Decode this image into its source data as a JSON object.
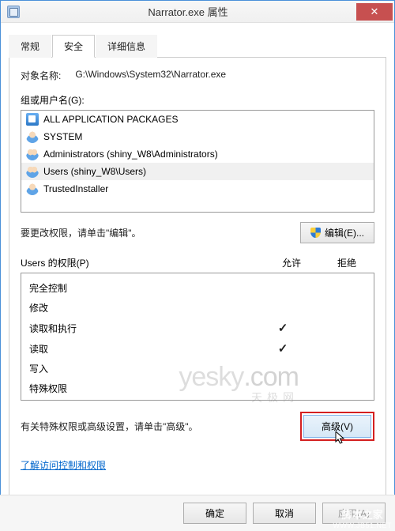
{
  "title": "Narrator.exe 属性",
  "tabs": {
    "general": "常规",
    "security": "安全",
    "details": "详细信息"
  },
  "object": {
    "label": "对象名称:",
    "path": "G:\\Windows\\System32\\Narrator.exe"
  },
  "groups": {
    "label": "组或用户名(G):",
    "items": [
      {
        "name": "ALL APPLICATION PACKAGES",
        "ico": "ico-pkg"
      },
      {
        "name": "SYSTEM",
        "ico": "ico-user"
      },
      {
        "name": "Administrators (shiny_W8\\Administrators)",
        "ico": "ico-users"
      },
      {
        "name": "Users (shiny_W8\\Users)",
        "ico": "ico-users"
      },
      {
        "name": "TrustedInstaller",
        "ico": "ico-user"
      }
    ]
  },
  "edit": {
    "text": "要更改权限，请单击\"编辑\"。",
    "button": "编辑(E)..."
  },
  "perms": {
    "header": "Users 的权限(P)",
    "allow": "允许",
    "deny": "拒绝",
    "rows": [
      {
        "name": "完全控制",
        "allow": false,
        "deny": false
      },
      {
        "name": "修改",
        "allow": false,
        "deny": false
      },
      {
        "name": "读取和执行",
        "allow": true,
        "deny": false
      },
      {
        "name": "读取",
        "allow": true,
        "deny": false
      },
      {
        "name": "写入",
        "allow": false,
        "deny": false
      },
      {
        "name": "特殊权限",
        "allow": false,
        "deny": false
      }
    ]
  },
  "advanced": {
    "text": "有关特殊权限或高级设置，请单击\"高级\"。",
    "button": "高级(V)"
  },
  "link": "了解访问控制和权限",
  "buttons": {
    "ok": "确定",
    "cancel": "取消",
    "apply": "应用(A)"
  },
  "watermark": {
    "brand": "yesky",
    "sub": "天极网",
    "dom": ".com"
  },
  "corner": {
    "l1": "脚本之家",
    "l2": "WWW.JB51.NET"
  }
}
